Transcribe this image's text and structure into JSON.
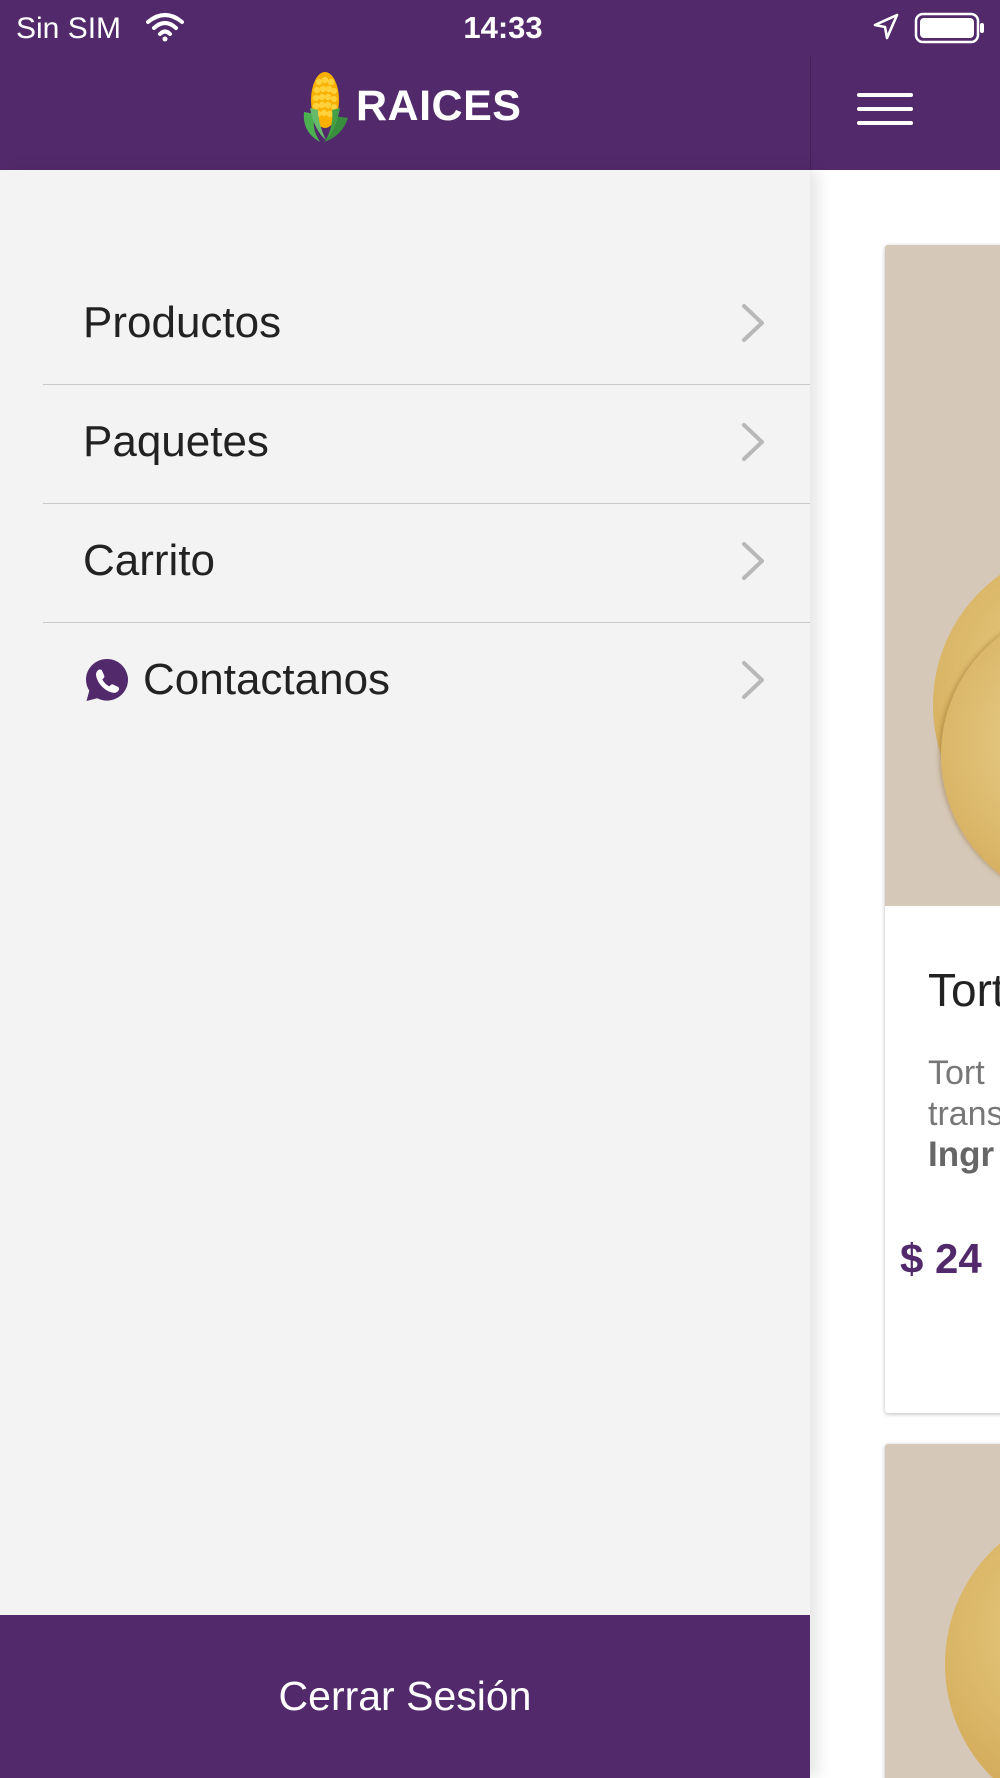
{
  "status_bar": {
    "carrier": "Sin SIM",
    "time": "14:33",
    "wifi_icon": "wifi-icon",
    "location_icon": "location-arrow-icon",
    "battery_icon": "battery-icon",
    "battery_level": 1.0
  },
  "header": {
    "brand": "RAICES",
    "logo_icon": "corn-icon",
    "menu_icon": "hamburger-menu-icon"
  },
  "drawer": {
    "items": [
      {
        "label": "Productos",
        "icon": ""
      },
      {
        "label": "Paquetes",
        "icon": ""
      },
      {
        "label": "Carrito",
        "icon": ""
      },
      {
        "label": "Contactanos",
        "icon": "whatsapp-icon"
      }
    ],
    "chevron_icon": "chevron-right-icon",
    "logout_label": "Cerrar Sesión"
  },
  "product_card": {
    "title": "Tort",
    "description_line1": "Tort",
    "description_line2": "trans",
    "ingredients_label": "Ingr",
    "price": "$ 24"
  },
  "colors": {
    "brand_purple": "#522a6c",
    "drawer_background": "#f3f3f3",
    "divider": "#c9c9c9",
    "chevron": "#b8b8b8",
    "image_background": "#d6c8b8"
  }
}
